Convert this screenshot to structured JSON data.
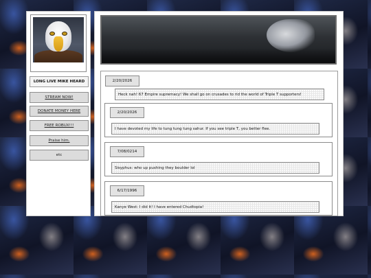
{
  "sidebar": {
    "avatar_icon": "bald-eagle",
    "motto": "LONG LIVE MIKE HEARD",
    "nav": [
      {
        "label": "STREAM NOW!"
      },
      {
        "label": "DONATE MONEY HERE"
      },
      {
        "label": "FREE ROBUX!!!"
      },
      {
        "label": "Praise him."
      },
      {
        "label": "etc"
      }
    ]
  },
  "banner": {
    "icon": "wolf-night-banner"
  },
  "posts": [
    {
      "date": "2/20/2026",
      "text": "Heck nah! 67 Empire supremacy! We shall go on crusades to rid the world of Triple T supporters!"
    },
    {
      "date": "2/20/2026",
      "text": "I have devoted my life to tung tung tung sahur. If you see triple T, you better flee."
    },
    {
      "date": "7/08/0214",
      "text": "Sisyphus: who up pushing they boulder lol"
    },
    {
      "date": "6/17/1996",
      "text": "Kanye West: I did it! I have entered Chudtopia!"
    }
  ]
}
